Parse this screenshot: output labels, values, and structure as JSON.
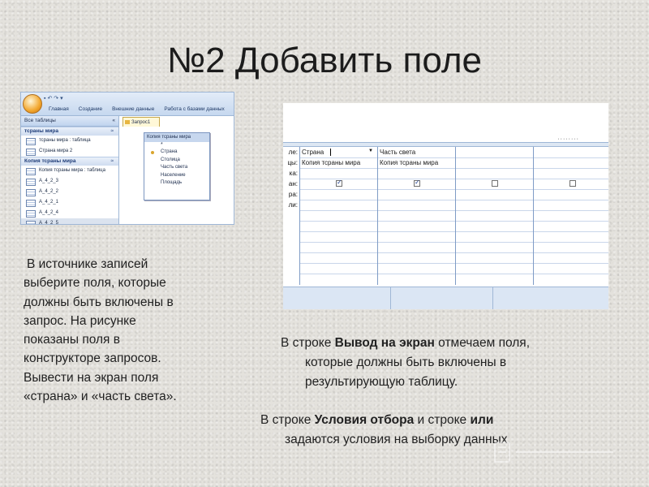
{
  "slide": {
    "title": "№2 Добавить поле"
  },
  "screenshot_left": {
    "ribbon_tabs": [
      "Главная",
      "Создание",
      "Внешние данные",
      "Работа с базами данных"
    ],
    "nav_header": "Все таблицы",
    "nav_header_chevron": "«",
    "groups": [
      {
        "name": "тсраны мира",
        "chevron": "≈",
        "items": [
          {
            "label": "тсраны мира : таблица",
            "selected": false
          },
          {
            "label": "Страна мира 2",
            "selected": false
          }
        ]
      },
      {
        "name": "Копия тсраны мира",
        "chevron": "≈",
        "items": [
          {
            "label": "Копия тсраны мира : таблица",
            "selected": false
          },
          {
            "label": "А_4_2_3",
            "selected": false
          },
          {
            "label": "А_4_2_2",
            "selected": false
          },
          {
            "label": "А_4_2_1",
            "selected": false
          },
          {
            "label": "А_4_2_4",
            "selected": false
          },
          {
            "label": "А_4_2_5",
            "selected": true
          }
        ]
      }
    ],
    "document_tab": "Запрос1",
    "table_box": {
      "title": "Копия тсраны мира",
      "star": "*",
      "fields": [
        "Страна",
        "Столица",
        "Часть света",
        "Население",
        "Площадь"
      ]
    }
  },
  "screenshot_right": {
    "dots": "········",
    "row_labels": [
      "ле:",
      "цы:",
      "ка:",
      "ан:",
      "ра:",
      "ли:"
    ],
    "columns": [
      {
        "field": "Страна",
        "table": "Копия тсраны мира",
        "show": true,
        "dropdown": true
      },
      {
        "field": "Часть света",
        "table": "Копия тсраны мира",
        "show": true,
        "dropdown": false
      },
      {
        "field": "",
        "table": "",
        "show": false,
        "dropdown": false
      },
      {
        "field": "",
        "table": "",
        "show": false,
        "dropdown": false
      }
    ]
  },
  "left_paragraph": [
    "В источнике записей",
    "выберите поля, которые",
    "должны быть включены в",
    "запрос. На рисунке",
    "показаны поля в",
    "конструкторе запросов.",
    "Вывести на экран поля",
    "«страна» и «часть света»."
  ],
  "right_paragraph_1": {
    "prefix": "В строке ",
    "bold": "Вывод на экран",
    "suffix": " отмечаем поля,",
    "line2": "которые должны быть включены в",
    "line3": "результирующую таблицу."
  },
  "right_paragraph_2": {
    "prefix": "В строке ",
    "bold1": "Условия отбора",
    "middle": " и строке ",
    "bold2": "или",
    "line2": "задаются условия на выборку данных"
  }
}
